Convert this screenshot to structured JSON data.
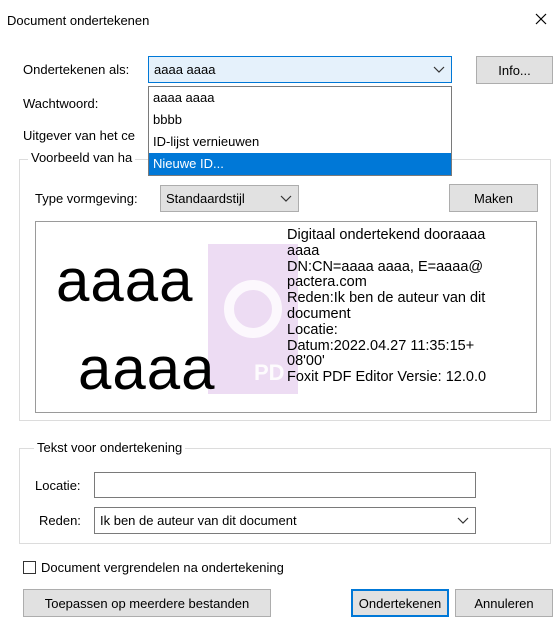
{
  "window": {
    "title": "Document ondertekenen"
  },
  "sign_as": {
    "label": "Ondertekenen als:",
    "value": "aaaa aaaa",
    "info_button": "Info..."
  },
  "dropdown": {
    "items": [
      "aaaa aaaa",
      "bbbb",
      "ID-lijst vernieuwen",
      "Nieuwe ID..."
    ],
    "selected_index": 3
  },
  "password": {
    "label": "Wachtwoord:"
  },
  "issuer": {
    "label": "Uitgever van het ce"
  },
  "preview_group": {
    "title": "Voorbeeld van ha",
    "style_label": "Type vormgeving:",
    "style_value": "Standaardstijl",
    "make_button": "Maken",
    "name_line1": "aaaa",
    "name_line2": "aaaa",
    "watermark": "PD",
    "details": [
      "Digitaal ondertekend dooraaaa",
      "aaaa",
      "DN:CN=aaaa aaaa, E=aaaa@",
      "pactera.com",
      "Reden:Ik ben de auteur van dit",
      "document",
      "Locatie:",
      "Datum:2022.04.27 11:35:15+",
      "08'00'",
      "Foxit PDF Editor Versie: 12.0.0"
    ]
  },
  "text_group": {
    "title": "Tekst voor ondertekening",
    "location_label": "Locatie:",
    "location_value": "",
    "reason_label": "Reden:",
    "reason_value": "Ik ben de auteur van dit document"
  },
  "lock_checkbox": {
    "label": "Document vergrendelen na ondertekening",
    "checked": false
  },
  "buttons": {
    "apply_multiple": "Toepassen op meerdere bestanden",
    "sign": "Ondertekenen",
    "cancel": "Annuleren"
  },
  "colors": {
    "accent": "#0078d7",
    "watermark": "#c9a4d8"
  }
}
